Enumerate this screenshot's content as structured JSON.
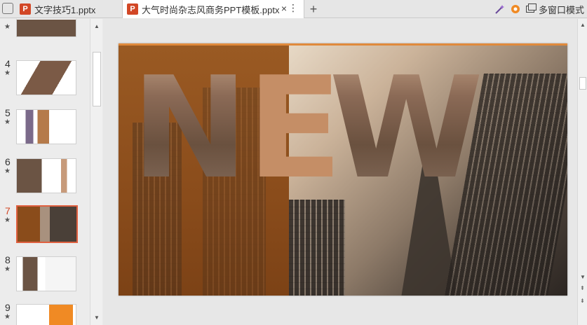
{
  "tabs": [
    {
      "label": "文字技巧1.pptx"
    },
    {
      "label": "大气时尚杂志风商务PPT模板.pptx"
    }
  ],
  "tab_app_icon": "P",
  "toolbar": {
    "multi_window_label": "多窗口模式",
    "plus_icon": "+",
    "close_icon": "×",
    "more_icon": "⋮"
  },
  "thumbnails": [
    {
      "number": "",
      "star": "★"
    },
    {
      "number": "4",
      "star": "★"
    },
    {
      "number": "5",
      "star": "★"
    },
    {
      "number": "6",
      "star": "★"
    },
    {
      "number": "7",
      "star": "★",
      "active": true
    },
    {
      "number": "8",
      "star": "★"
    },
    {
      "number": "9",
      "star": "★"
    }
  ],
  "slide": {
    "letters": [
      "N",
      "E",
      "W"
    ]
  },
  "colors": {
    "accent": "#d24726",
    "slide_brown": "#8a4c1b",
    "letter_e": "#c58e66"
  }
}
